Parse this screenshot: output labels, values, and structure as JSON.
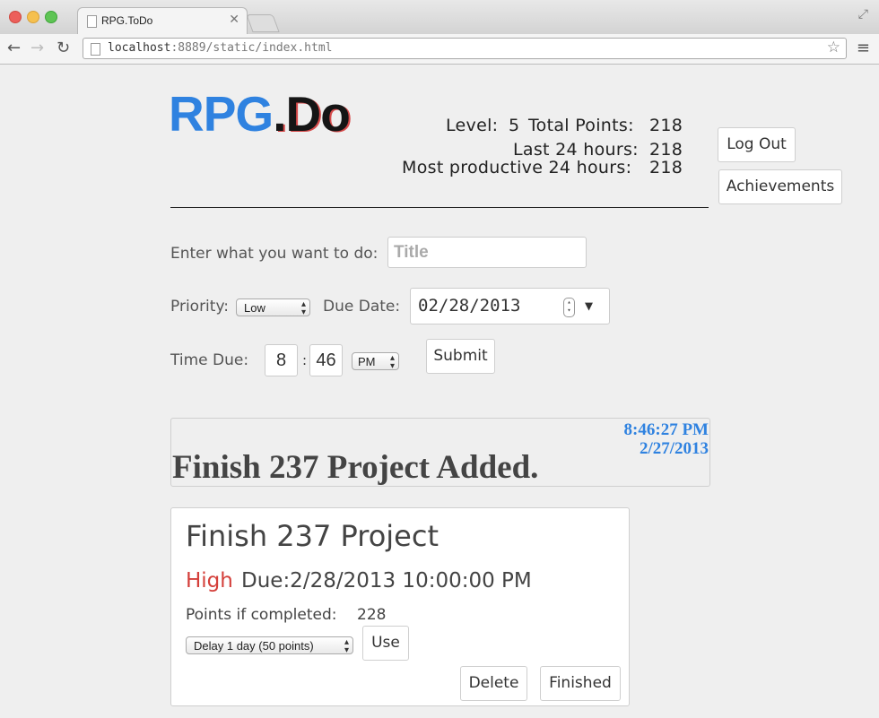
{
  "browser": {
    "tab_title": "RPG.ToDo",
    "url_host": "localhost",
    "url_rest": ":8889/static/index.html"
  },
  "header": {
    "logo_part1": "RPG",
    "logo_part2": ".Do",
    "level_label": "Level:",
    "level_value": "5",
    "total_label": "Total Points:",
    "total_value": "218",
    "last24_label": "Last 24 hours:",
    "last24_value": "218",
    "most_label": "Most productive 24 hours:",
    "most_value": "218",
    "logout_label": "Log Out",
    "achievements_label": "Achievements"
  },
  "form": {
    "title_label": "Enter what you want to do:",
    "title_placeholder": "Title",
    "priority_label": "Priority:",
    "priority_value": "Low",
    "due_date_label": "Due Date:",
    "due_date_value": "02/28/2013",
    "time_due_label": "Time Due:",
    "hour_value": "8",
    "minute_value": "46",
    "ampm_value": "PM",
    "submit_label": "Submit"
  },
  "notice": {
    "time": "8:46:27 PM",
    "date": "2/27/2013",
    "message": "Finish 237 Project Added."
  },
  "task": {
    "title": "Finish 237 Project",
    "priority": "High",
    "due": "Due:2/28/2013 10:00:00 PM",
    "points_label": "Points if completed:",
    "points_value": "228",
    "delay_option": "Delay 1 day (50 points)",
    "use_label": "Use",
    "delete_label": "Delete",
    "finished_label": "Finished"
  },
  "colors": {
    "accent_blue": "#2f82e0",
    "priority_high": "#d43f3a"
  }
}
